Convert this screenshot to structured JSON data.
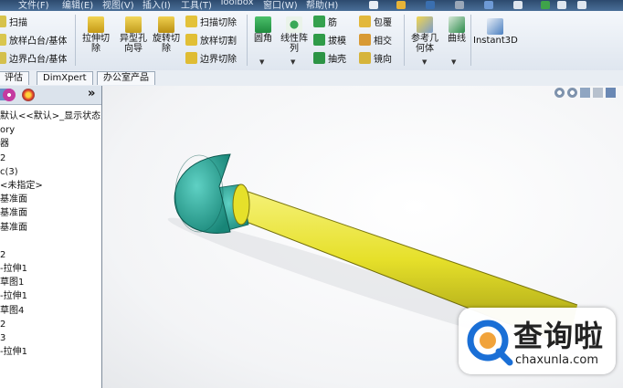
{
  "menu": {
    "items": [
      "文件(F)",
      "编辑(E)",
      "视图(V)",
      "插入(I)",
      "工具(T)",
      "Toolbox",
      "窗口(W)",
      "帮助(H)"
    ]
  },
  "ribbon": {
    "left_col": [
      "扫描",
      "放样凸台/基体",
      "边界凸台/基体"
    ],
    "extrude_cut": "拉伸切\n除",
    "hole_wizard": "异型孔\n向导",
    "revolve_cut": "旋转切\n除",
    "cut_col": [
      "扫描切除",
      "放样切割",
      "边界切除"
    ],
    "fillet": "圆角",
    "linear_pattern": "线性阵\n列",
    "feat_col1": [
      "筋",
      "拔模",
      "抽壳"
    ],
    "feat_col2": [
      "包覆",
      "相交",
      "镜向"
    ],
    "ref_geom": "参考几\n何体",
    "curves": "曲线",
    "instant3d": "Instant3D"
  },
  "tabs": [
    "评估",
    "DimXpert",
    "办公室产品"
  ],
  "feature_tree": {
    "expand_label": "»",
    "rows": [
      "默认<<默认>_显示状态",
      "ory",
      "器",
      "2",
      "c(3)",
      "<未指定>",
      "基准面",
      "基准面",
      "基准面",
      "",
      "2",
      "-拉伸1",
      "草图1",
      "-拉伸1",
      "草图4",
      "2",
      "3",
      "-拉伸1"
    ]
  },
  "watermark": {
    "title": "查询啦",
    "url": "chaxunla.com"
  },
  "colors": {
    "part_yellow": "#e6e02a",
    "part_teal": "#2aa99a",
    "brand_blue": "#1a6fd6"
  }
}
